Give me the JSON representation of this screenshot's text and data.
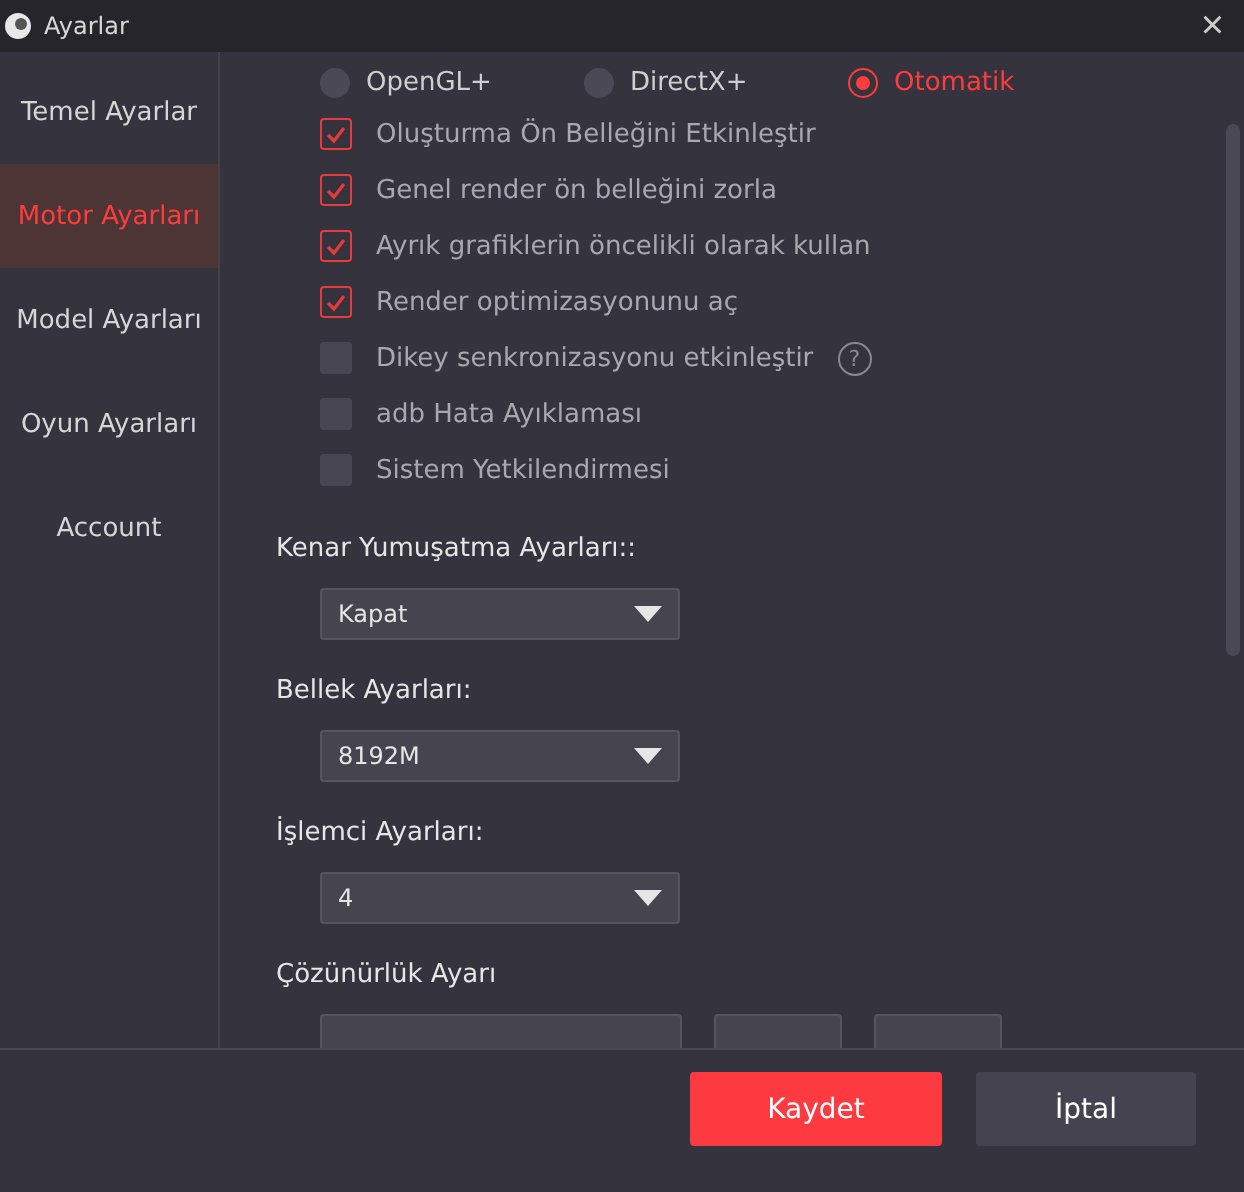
{
  "window": {
    "title": "Ayarlar",
    "close": "×"
  },
  "sidebar": {
    "items": [
      {
        "label": "Temel Ayarlar",
        "selected": false
      },
      {
        "label": "Motor Ayarları",
        "selected": true
      },
      {
        "label": "Model Ayarları",
        "selected": false
      },
      {
        "label": "Oyun Ayarları",
        "selected": false
      },
      {
        "label": "Account",
        "selected": false
      }
    ]
  },
  "renderer": [
    {
      "label": "OpenGL+",
      "selected": false
    },
    {
      "label": "DirectX+",
      "selected": false
    },
    {
      "label": "Otomatik",
      "selected": true
    }
  ],
  "options": [
    {
      "label": "Oluşturma Ön Belleğini Etkinleştir",
      "checked": true
    },
    {
      "label": "Genel render ön belleğini zorla",
      "checked": true
    },
    {
      "label": "Ayrık grafiklerin öncelikli olarak kullan",
      "checked": true
    },
    {
      "label": "Render optimizasyonunu aç",
      "checked": true
    },
    {
      "label": "Dikey senkronizasyonu etkinleştir",
      "checked": false,
      "help_mark": "?"
    },
    {
      "label": "adb Hata Ayıklaması",
      "checked": false
    },
    {
      "label": "Sistem Yetkilendirmesi",
      "checked": false
    }
  ],
  "selects": [
    {
      "label": "Kenar Yumuşatma Ayarları::",
      "value": "Kapat"
    },
    {
      "label": "Bellek Ayarları:",
      "value": "8192M"
    },
    {
      "label": "İşlemci Ayarları:",
      "value": "4"
    }
  ],
  "resolution": {
    "label": "Çözünürlük Ayarı"
  },
  "buttons": [
    {
      "label": "Kaydet",
      "kind": "primary"
    },
    {
      "label": "İptal",
      "kind": "secondary"
    }
  ]
}
